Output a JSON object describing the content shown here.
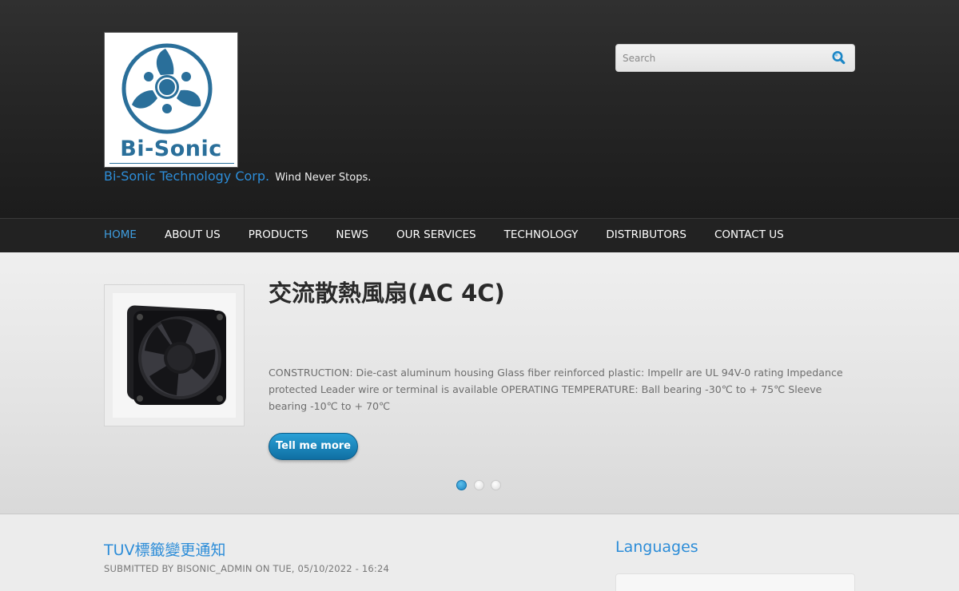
{
  "header": {
    "logo_text": "Bi-Sonic",
    "site_name": "Bi-Sonic Technology Corp.",
    "slogan": "Wind Never Stops.",
    "search_placeholder": "Search",
    "search_icon": "magnifier-icon"
  },
  "nav": {
    "items": [
      {
        "label": "HOME",
        "active": true
      },
      {
        "label": "ABOUT US"
      },
      {
        "label": "PRODUCTS"
      },
      {
        "label": "NEWS"
      },
      {
        "label": "OUR SERVICES"
      },
      {
        "label": "TECHNOLOGY"
      },
      {
        "label": "DISTRIBUTORS"
      },
      {
        "label": "CONTACT US"
      }
    ]
  },
  "slider": {
    "title": "交流散熱風扇(AC 4C)",
    "description": "CONSTRUCTION: Die-cast aluminum housing Glass fiber reinforced plastic: Impellr are UL 94V-0 rating Impedance protected Leader wire or terminal is available OPERATING TEMPERATURE: Ball bearing -30℃ to + 75℃ Sleeve bearing -10℃ to + 70℃",
    "button_label": "Tell me more",
    "slide_count": 3,
    "active_slide": 1
  },
  "article": {
    "title": "TUV標籤變更通知",
    "meta": "SUBMITTED BY BISONIC_ADMIN ON TUE, 05/10/2022 - 16:24"
  },
  "sidebar": {
    "title": "Languages"
  },
  "colors": {
    "accent": "#2d8dd8",
    "header_bg": "#262626",
    "nav_bg": "#222222",
    "button": "#1a84c2"
  }
}
